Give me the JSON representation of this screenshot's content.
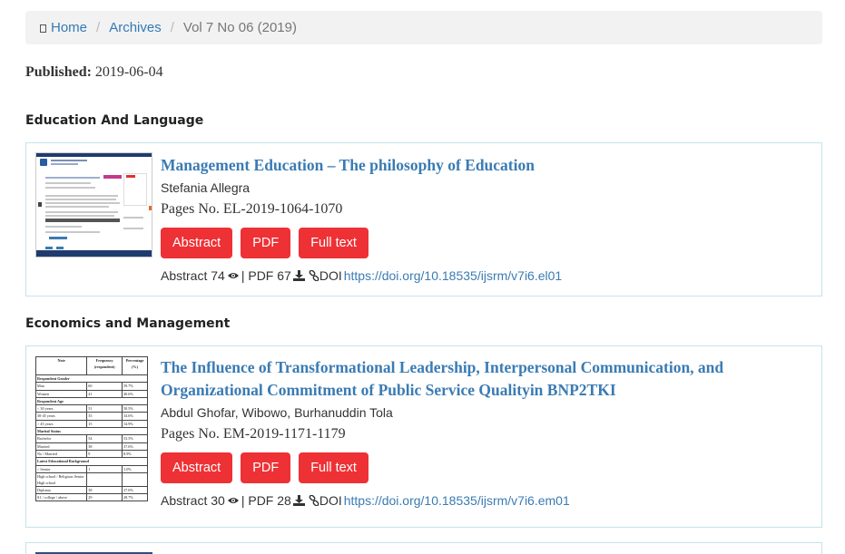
{
  "breadcrumb": {
    "home": "Home",
    "archives": "Archives",
    "current": "Vol 7 No 06 (2019)"
  },
  "published": {
    "label": "Published:",
    "date": "2019-06-04"
  },
  "sections": [
    {
      "title": "Education And Language",
      "article": {
        "title": "Management Education – The philosophy of Education",
        "authors": "Stefania Allegra",
        "pages": "Pages No. EL-2019-1064-1070",
        "buttons": [
          "Abstract",
          "PDF",
          "Full text"
        ],
        "stats_abstract": "Abstract 74",
        "stats_pdf": "| PDF 67",
        "stats_doi_label": "DOI",
        "doi": "https://doi.org/10.18535/ijsrm/v7i6.el01"
      }
    },
    {
      "title": "Economics and Management",
      "article": {
        "title": "The Influence of Transformational Leadership, Interpersonal Communication, and Organizational Commitment of Public Service Qualityin BNP2TKI",
        "authors": "Abdul Ghofar, Wibowo, Burhanuddin Tola",
        "pages": "Pages No. EM-2019-1171-1179",
        "buttons": [
          "Abstract",
          "PDF",
          "Full text"
        ],
        "stats_abstract": "Abstract 30",
        "stats_pdf": "| PDF 28",
        "stats_doi_label": "DOI",
        "doi": "https://doi.org/10.18535/ijsrm/v7i6.em01"
      }
    }
  ],
  "thumb_table": {
    "headers": [
      "Note",
      "Frequency (respondent)",
      "Percentage (%)"
    ],
    "rows": [
      [
        "Respondent Gender",
        "",
        ""
      ],
      [
        "Man",
        "60",
        "59.7%"
      ],
      [
        "Women",
        "41",
        "40.6%"
      ],
      [
        "Respondent Age",
        "",
        ""
      ],
      [
        "< 30 years",
        "51",
        "50.5%"
      ],
      [
        "30-45 years",
        "35",
        "34.6%"
      ],
      [
        "> 45 years",
        "15",
        "14.9%"
      ],
      [
        "Marital Status",
        "",
        ""
      ],
      [
        "Bachelor",
        "54",
        "53.5%"
      ],
      [
        "Married",
        "38",
        "37.6%"
      ],
      [
        "No / Married",
        "9",
        "8.9%"
      ],
      [
        "Latest Educational Background",
        "",
        ""
      ],
      [
        "< Senior",
        "1",
        "1.0%"
      ],
      [
        "High school / Religious Senior High school",
        "",
        ""
      ],
      [
        "Diploma",
        "38",
        "37.6%"
      ],
      [
        "S1 / college / above",
        "29",
        "28.7%"
      ]
    ]
  },
  "colors": {
    "accent": "#3a7bb3",
    "button": "#ee3135",
    "border": "#c6e2ec"
  }
}
